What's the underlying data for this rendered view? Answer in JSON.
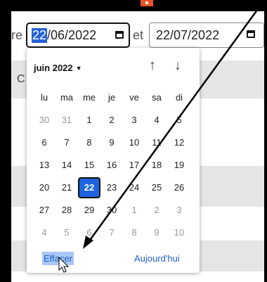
{
  "page": {
    "left_fragment": "re",
    "left_letter": "C"
  },
  "range": {
    "start_day": "22",
    "start_rest": "/06/2022",
    "separator": "et",
    "end_value": "22/07/2022"
  },
  "calendar": {
    "month_label": "juin 2022",
    "weekdays": [
      "lu",
      "ma",
      "me",
      "je",
      "ve",
      "sa",
      "di"
    ],
    "weeks": [
      [
        "30",
        "31",
        "1",
        "2",
        "3",
        "4",
        "5"
      ],
      [
        "6",
        "7",
        "8",
        "9",
        "10",
        "11",
        "12"
      ],
      [
        "13",
        "14",
        "15",
        "16",
        "17",
        "18",
        "19"
      ],
      [
        "20",
        "21",
        "22",
        "23",
        "24",
        "25",
        "26"
      ],
      [
        "27",
        "28",
        "29",
        "30",
        "1",
        "2",
        "3"
      ],
      [
        "4",
        "5",
        "6",
        "7",
        "8",
        "9",
        "10"
      ]
    ],
    "selected_day": "22",
    "clear_label": "Effacer",
    "today_label": "Aujourd'hui"
  },
  "colors": {
    "accent": "#1e64e0",
    "highlight": "#a9c7f5",
    "frame": "#000000",
    "tab": "#e8542a"
  }
}
